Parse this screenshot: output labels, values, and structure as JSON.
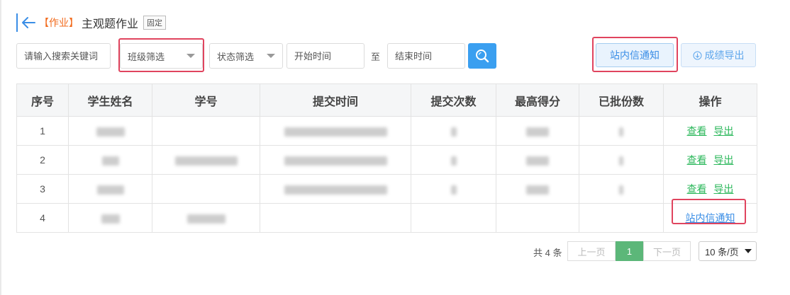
{
  "header": {
    "tag": "【作业】",
    "title": "主观题作业",
    "badge": "固定"
  },
  "filters": {
    "keyword_placeholder": "请输入搜索关键词",
    "class_filter": "班级筛选",
    "status_filter": "状态筛选",
    "start_time_placeholder": "开始时间",
    "to_label": "至",
    "end_time_placeholder": "结束时间"
  },
  "actions": {
    "notify": "站内信通知",
    "export": "成绩导出"
  },
  "table": {
    "columns": [
      "序号",
      "学生姓名",
      "学号",
      "提交时间",
      "提交次数",
      "最高得分",
      "已批份数",
      "操作"
    ],
    "rows": [
      {
        "index": "1",
        "ops": [
          "查看",
          "导出"
        ]
      },
      {
        "index": "2",
        "ops": [
          "查看",
          "导出"
        ]
      },
      {
        "index": "3",
        "ops": [
          "查看",
          "导出"
        ]
      },
      {
        "index": "4",
        "ops": [
          "站内信通知"
        ]
      }
    ]
  },
  "pagination": {
    "total": "共 4 条",
    "prev": "上一页",
    "current": "1",
    "next": "下一页",
    "page_size": "10 条/页"
  },
  "colors": {
    "accent": "#3a8ee6",
    "tag": "#f26b1d",
    "link_green": "#2db85c",
    "highlight": "#e0445e",
    "page_active": "#5cb779"
  }
}
